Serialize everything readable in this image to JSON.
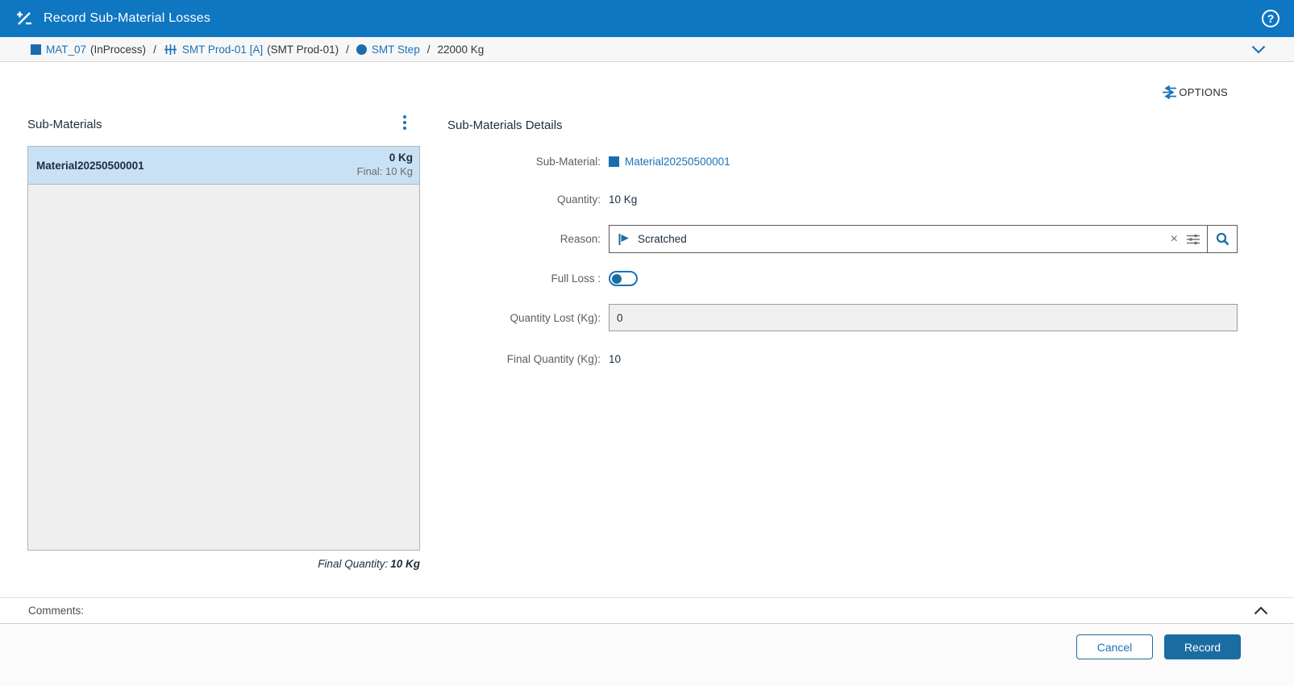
{
  "header": {
    "title": "Record Sub-Material Losses"
  },
  "breadcrumb": {
    "separator": "/",
    "material_name": "MAT_07",
    "material_state": "(InProcess)",
    "equipment_name": "SMT Prod-01 [A]",
    "equipment_alias": "(SMT Prod-01)",
    "step_name": "SMT Step",
    "quantity": "22000 Kg"
  },
  "toolbar": {
    "options_label": "OPTIONS"
  },
  "sub_materials_panel": {
    "title": "Sub-Materials",
    "items": [
      {
        "name": "Material20250500001",
        "lost": "0 Kg",
        "final": "Final: 10 Kg"
      }
    ],
    "final_quantity_label": "Final Quantity:",
    "final_quantity_value": "10 Kg"
  },
  "details_panel": {
    "title": "Sub-Materials Details",
    "fields": {
      "sub_material": {
        "label": "Sub-Material:",
        "value": "Material20250500001"
      },
      "quantity": {
        "label": "Quantity:",
        "value": "10 Kg"
      },
      "reason": {
        "label": "Reason:",
        "value": "Scratched",
        "clear_icon": "×"
      },
      "full_loss": {
        "label": "Full Loss :",
        "state": "off"
      },
      "quantity_lost": {
        "label": "Quantity Lost (Kg):",
        "value": "0"
      },
      "final_quantity": {
        "label": "Final Quantity (Kg):",
        "value": "10"
      }
    }
  },
  "comments": {
    "label": "Comments:"
  },
  "footer": {
    "cancel_label": "Cancel",
    "record_label": "Record"
  },
  "colors": {
    "header_blue": "#0f76c2",
    "link_blue": "#1b72b8",
    "record_button_blue": "#1b6da1",
    "selected_row_blue": "#c9e1f4",
    "list_background": "#efefef"
  }
}
